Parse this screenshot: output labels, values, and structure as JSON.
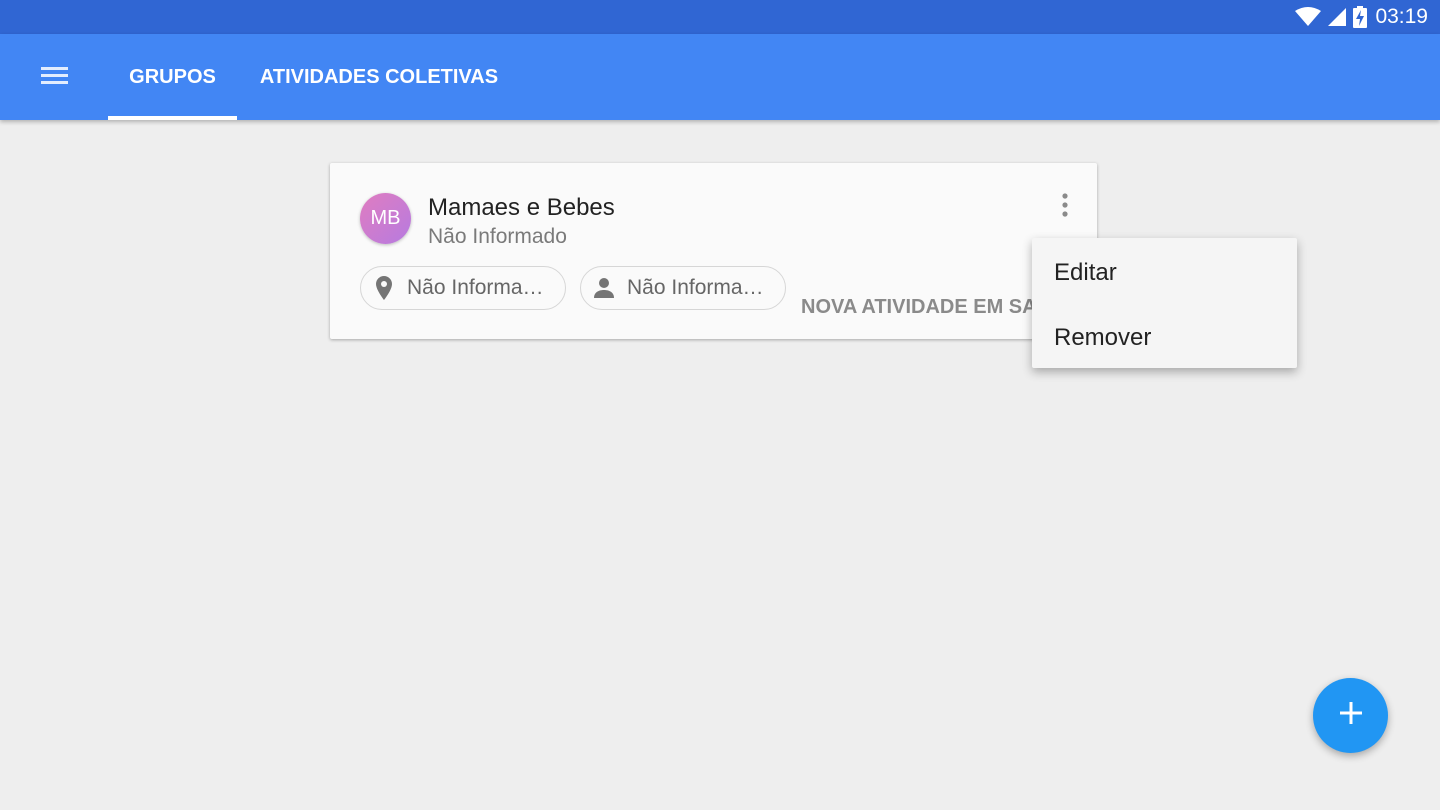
{
  "status_bar": {
    "time": "03:19",
    "icons": [
      "wifi-icon",
      "signal-icon",
      "battery-charging-icon"
    ]
  },
  "app_bar": {
    "menu_icon": "hamburger-menu-icon",
    "tabs": [
      {
        "label": "GRUPOS",
        "selected": true
      },
      {
        "label": "ATIVIDADES COLETIVAS",
        "selected": false
      }
    ]
  },
  "group_card": {
    "avatar_initials": "MB",
    "title": "Mamaes e Bebes",
    "subtitle": "Não Informado",
    "more_icon": "more-vert-icon",
    "chips": [
      {
        "icon": "location-pin-icon",
        "label": "Não Informa…"
      },
      {
        "icon": "person-icon",
        "label": "Não Informa…"
      }
    ],
    "action_label": "NOVA ATIVIDADE EM SALA"
  },
  "context_menu": {
    "items": [
      {
        "label": "Editar"
      },
      {
        "label": "Remover"
      }
    ]
  },
  "fab": {
    "icon": "plus-icon"
  },
  "colors": {
    "status_bar": "#3066d3",
    "app_bar": "#4286f4",
    "background": "#eeeeee",
    "fab": "#2196f3",
    "avatar_gradient_start": "#e07cc0",
    "avatar_gradient_end": "#b67be0"
  }
}
